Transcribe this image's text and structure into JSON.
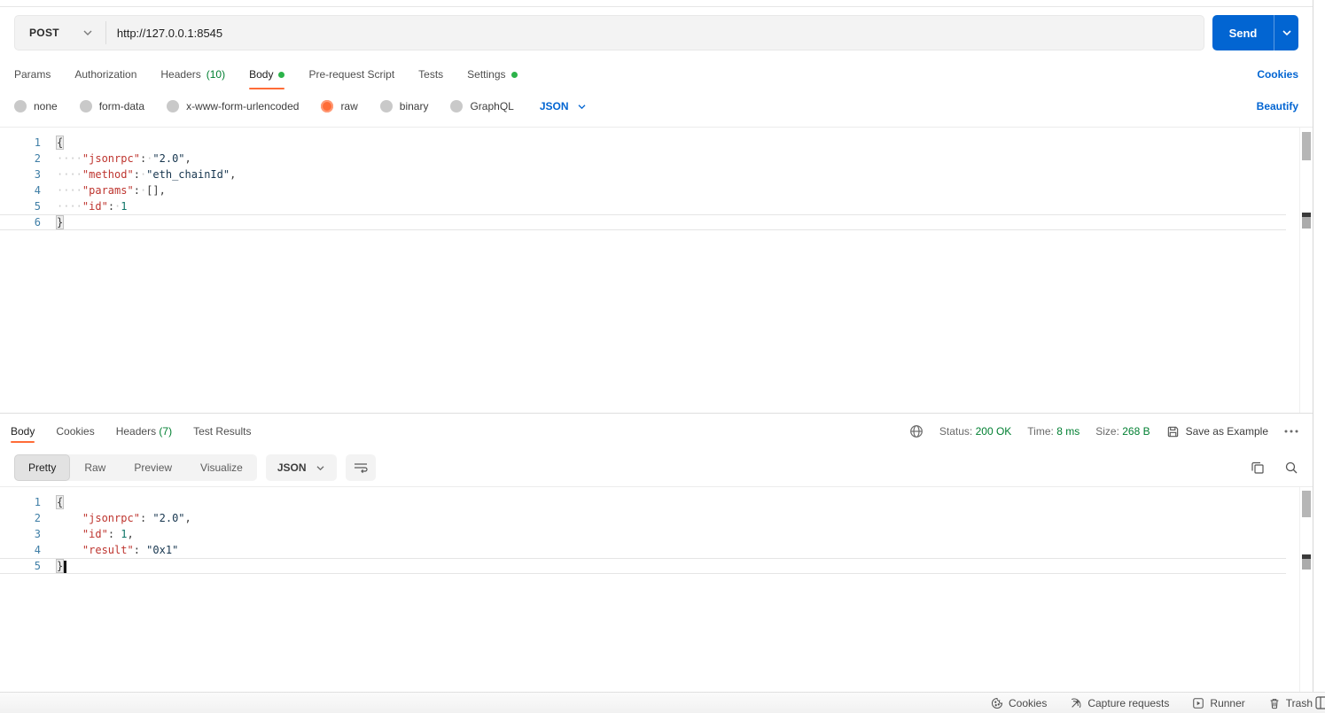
{
  "request": {
    "method": "POST",
    "url": "http://127.0.0.1:8545",
    "send_label": "Send",
    "tabs": {
      "params": "Params",
      "authorization": "Authorization",
      "headers": "Headers",
      "headers_count": "(10)",
      "body": "Body",
      "prerequest": "Pre-request Script",
      "tests": "Tests",
      "settings": "Settings"
    },
    "cookies_link": "Cookies",
    "modes": {
      "none": "none",
      "form_data": "form-data",
      "urlencoded": "x-www-form-urlencoded",
      "raw": "raw",
      "binary": "binary",
      "graphql": "GraphQL"
    },
    "language": "JSON",
    "beautify_link": "Beautify",
    "code": [
      {
        "n": "1",
        "tokens": [
          {
            "c": "brace",
            "t": "{"
          }
        ]
      },
      {
        "n": "2",
        "tokens": [
          {
            "c": "ws",
            "t": "····"
          },
          {
            "c": "key",
            "t": "\"jsonrpc\""
          },
          {
            "c": "punc",
            "t": ":"
          },
          {
            "c": "ws",
            "t": "·"
          },
          {
            "c": "str",
            "t": "\"2.0\""
          },
          {
            "c": "punc",
            "t": ","
          }
        ]
      },
      {
        "n": "3",
        "tokens": [
          {
            "c": "ws",
            "t": "····"
          },
          {
            "c": "key",
            "t": "\"method\""
          },
          {
            "c": "punc",
            "t": ":"
          },
          {
            "c": "ws",
            "t": "·"
          },
          {
            "c": "str",
            "t": "\"eth_chainId\""
          },
          {
            "c": "punc",
            "t": ","
          }
        ]
      },
      {
        "n": "4",
        "tokens": [
          {
            "c": "ws",
            "t": "····"
          },
          {
            "c": "key",
            "t": "\"params\""
          },
          {
            "c": "punc",
            "t": ":"
          },
          {
            "c": "ws",
            "t": "·"
          },
          {
            "c": "punc",
            "t": "[],"
          }
        ]
      },
      {
        "n": "5",
        "tokens": [
          {
            "c": "ws",
            "t": "····"
          },
          {
            "c": "key",
            "t": "\"id\""
          },
          {
            "c": "punc",
            "t": ":"
          },
          {
            "c": "ws",
            "t": "·"
          },
          {
            "c": "num",
            "t": "1"
          }
        ]
      },
      {
        "n": "6",
        "current": true,
        "tokens": [
          {
            "c": "brace",
            "t": "}"
          }
        ]
      }
    ]
  },
  "response": {
    "tabs": {
      "body": "Body",
      "cookies": "Cookies",
      "headers": "Headers",
      "headers_count": "(7)",
      "test_results": "Test Results"
    },
    "meta": {
      "status_label": "Status:",
      "status_value": "200 OK",
      "time_label": "Time:",
      "time_value": "8 ms",
      "size_label": "Size:",
      "size_value": "268 B",
      "save_as_example": "Save as Example"
    },
    "views": {
      "pretty": "Pretty",
      "raw": "Raw",
      "preview": "Preview",
      "visualize": "Visualize"
    },
    "language": "JSON",
    "code": [
      {
        "n": "1",
        "tokens": [
          {
            "c": "brace",
            "t": "{"
          }
        ]
      },
      {
        "n": "2",
        "tokens": [
          {
            "c": "ws",
            "t": "    "
          },
          {
            "c": "key",
            "t": "\"jsonrpc\""
          },
          {
            "c": "punc",
            "t": ":"
          },
          {
            "c": "ws",
            "t": " "
          },
          {
            "c": "str",
            "t": "\"2.0\""
          },
          {
            "c": "punc",
            "t": ","
          }
        ]
      },
      {
        "n": "3",
        "tokens": [
          {
            "c": "ws",
            "t": "    "
          },
          {
            "c": "key",
            "t": "\"id\""
          },
          {
            "c": "punc",
            "t": ":"
          },
          {
            "c": "ws",
            "t": " "
          },
          {
            "c": "num",
            "t": "1"
          },
          {
            "c": "punc",
            "t": ","
          }
        ]
      },
      {
        "n": "4",
        "tokens": [
          {
            "c": "ws",
            "t": "    "
          },
          {
            "c": "key",
            "t": "\"result\""
          },
          {
            "c": "punc",
            "t": ":"
          },
          {
            "c": "ws",
            "t": " "
          },
          {
            "c": "str",
            "t": "\"0x1\""
          }
        ]
      },
      {
        "n": "5",
        "current": true,
        "cursor": true,
        "tokens": [
          {
            "c": "brace",
            "t": "}"
          }
        ]
      }
    ]
  },
  "statusbar": {
    "cookies": "Cookies",
    "capture": "Capture requests",
    "runner": "Runner",
    "trash": "Trash"
  },
  "colors": {
    "accent_orange": "#FF6C37",
    "primary_blue": "#0265D2",
    "success_green": "#007F31",
    "dot_green": "#2CB34A"
  }
}
